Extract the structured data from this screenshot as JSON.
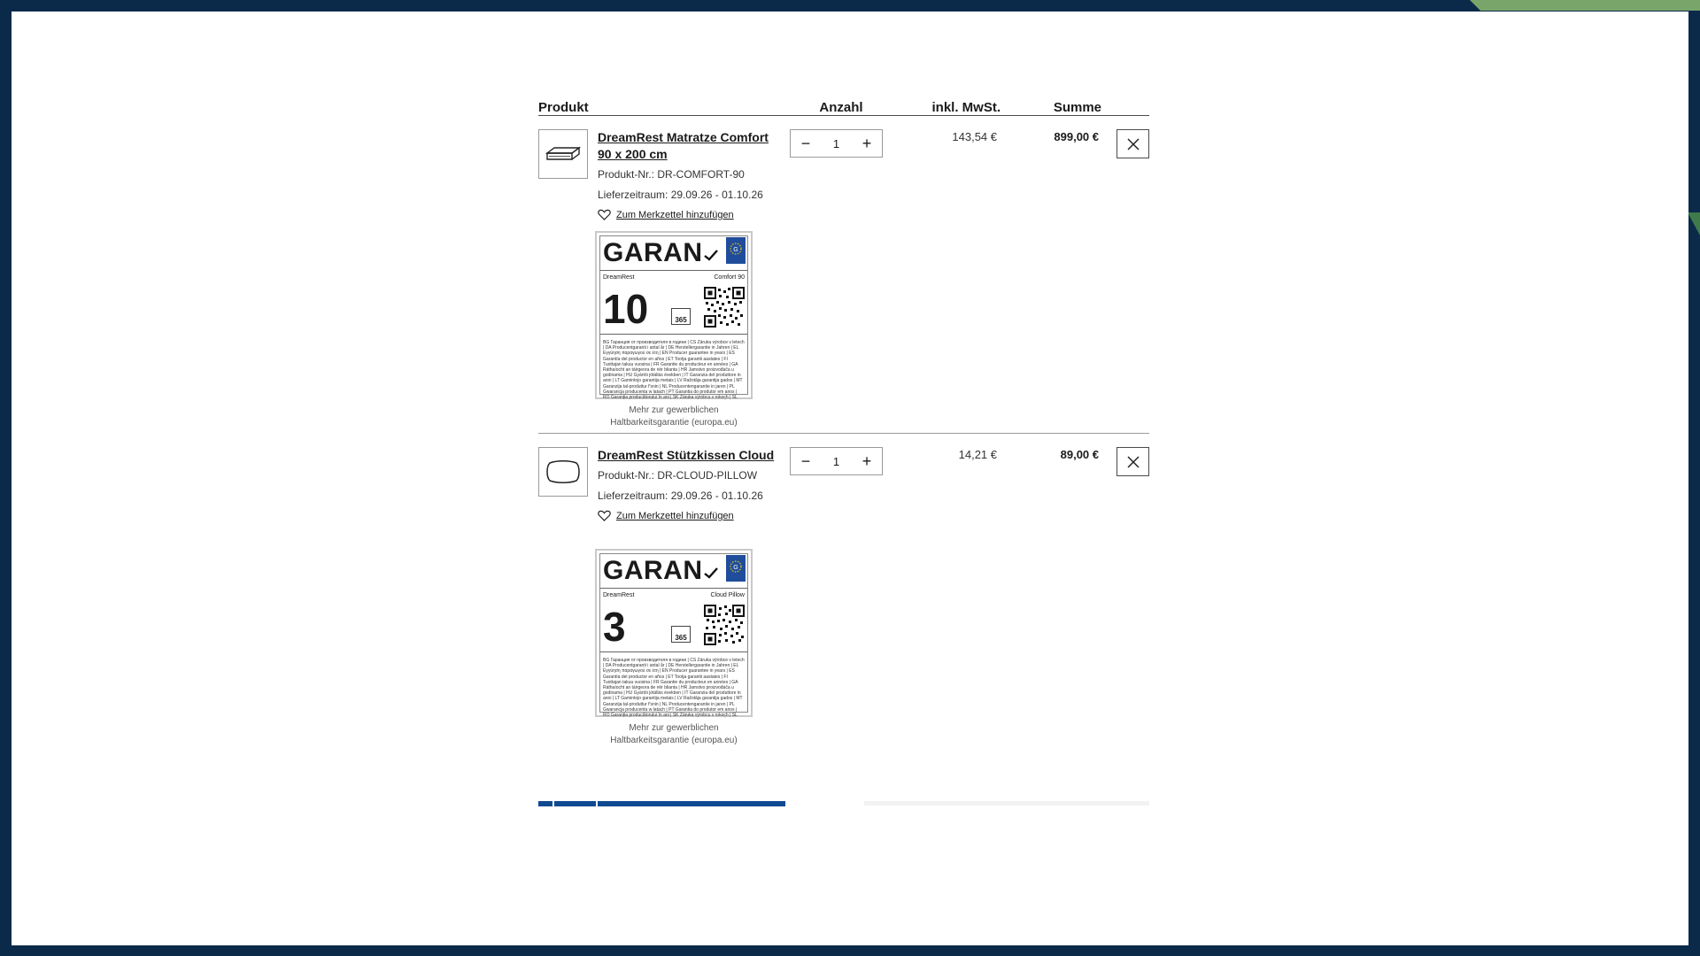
{
  "header": {
    "product": "Produkt",
    "quantity": "Anzahl",
    "vat": "inkl. MwSt.",
    "total": "Summe"
  },
  "items": [
    {
      "name": "DreamRest Matratze Comfort 90 x 200 cm",
      "number": "Produkt-Nr.: DR-COMFORT-90",
      "delivery": "Lieferzeitraum: 29.09.26 - 01.10.26",
      "wishlist": "Zum Merkzettel hinzufügen",
      "quantity": "1",
      "vat": "143,54 €",
      "total": "899,00 €",
      "label": {
        "logo": "GARAN",
        "brand": "DreamRest",
        "model": "Comfort 90",
        "years": "10",
        "days": "365"
      },
      "more_info": "Mehr zur gewerblichen Haltbarkeitsgarantie (europa.eu)"
    },
    {
      "name": "DreamRest Stützkissen Cloud",
      "number": "Produkt-Nr.: DR-CLOUD-PILLOW",
      "delivery": "Lieferzeitraum: 29.09.26 - 01.10.26",
      "wishlist": "Zum Merkzettel hinzufügen",
      "quantity": "1",
      "vat": "14,21 €",
      "total": "89,00 €",
      "label": {
        "logo": "GARAN",
        "brand": "DreamRest",
        "model": "Cloud Pillow",
        "years": "3",
        "days": "365"
      },
      "more_info": "Mehr zur gewerblichen Haltbarkeitsgarantie (europa.eu)"
    }
  ],
  "label_fine_print": "BG Гаранция от производителя в години | CS Záruka výrobce v letech | DA Producentgaranti i antal år | DE Herstellergarantie in Jahren | EL Εγγύηση παραγωγού σε έτη | EN Producer guarantee in years | ES Garantía del productor en años | ET Tootja garantii aastates | FI Tuottajan takuu vuosina | FR Garantie du producteur en années | GA Ráthaíocht an táirgeora de réir blianta | HR Jamstvo proizvođača u godinama | HU Gyártói jótállás években | IT Garanzia del produttore in anni | LT Gamintojo garantija metais | LV Ražotāja garantija gados | MT Garanzija tal-produttur f'snin | NL Producentengarantie in jaren | PL Gwarancja producenta w latach | PT Garantia do produtor em anos | RO Garanția producătorului în ani | SK Záruka výrobcu v rokoch | SL Garancija proizvajalca v letih | SV Tillverkarens garanti i antal år",
  "colors": {
    "frame": "#0b2a4a",
    "accent": "#7aa56a",
    "progress": "#0f4a91"
  },
  "icons": {
    "minus": "minus-icon",
    "plus": "plus-icon",
    "close": "close-icon",
    "heart": "heart-icon"
  }
}
